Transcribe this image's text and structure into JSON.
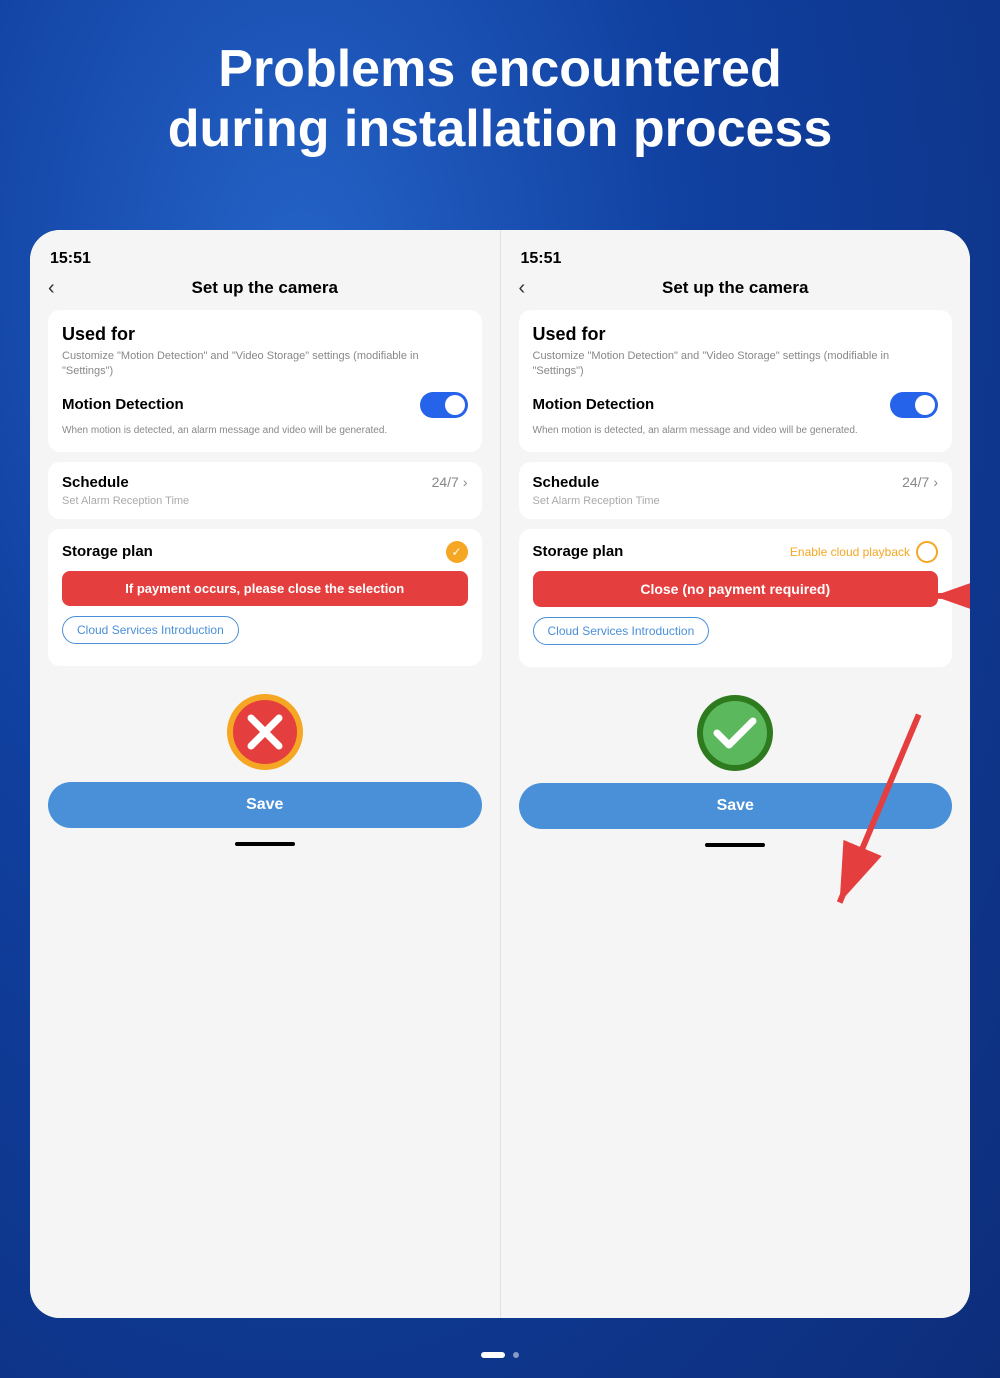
{
  "header": {
    "title_line1": "Problems encountered",
    "title_line2": "during installation process"
  },
  "left_panel": {
    "time": "15:51",
    "nav_title": "Set up  the camera",
    "back_icon": "‹",
    "used_for_title": "Used for",
    "used_for_desc": "Customize \"Motion Detection\" and \"Video Storage\" settings (modifiable in \"Settings\")",
    "motion_detection_label": "Motion Detection",
    "motion_detection_desc": "When motion is detected, an alarm message and video will be generated.",
    "schedule_label": "Schedule",
    "schedule_value": "24/7",
    "schedule_sub": "Set Alarm Reception Time",
    "storage_label": "Storage plan",
    "warning_btn_text": "If payment occurs, please close the selection",
    "cloud_link_text": "Cloud Services Introduction",
    "save_label": "Save",
    "home_indicator": ""
  },
  "right_panel": {
    "time": "15:51",
    "nav_title": "Set up  the camera",
    "back_icon": "‹",
    "used_for_title": "Used for",
    "used_for_desc": "Customize \"Motion Detection\" and \"Video Storage\" settings (modifiable in \"Settings\")",
    "motion_detection_label": "Motion Detection",
    "motion_detection_desc": "When motion is detected, an alarm message and video will be generated.",
    "schedule_label": "Schedule",
    "schedule_value": "24/7",
    "schedule_sub": "Set Alarm Reception Time",
    "storage_label": "Storage plan",
    "enable_cloud_text": "Enable cloud playback",
    "close_btn_text": "Close (no payment required)",
    "cloud_link_text": "Cloud Services Introduction",
    "save_label": "Save",
    "home_indicator": ""
  },
  "bottom": {
    "dot_active": "●",
    "dot_inactive": "·"
  }
}
